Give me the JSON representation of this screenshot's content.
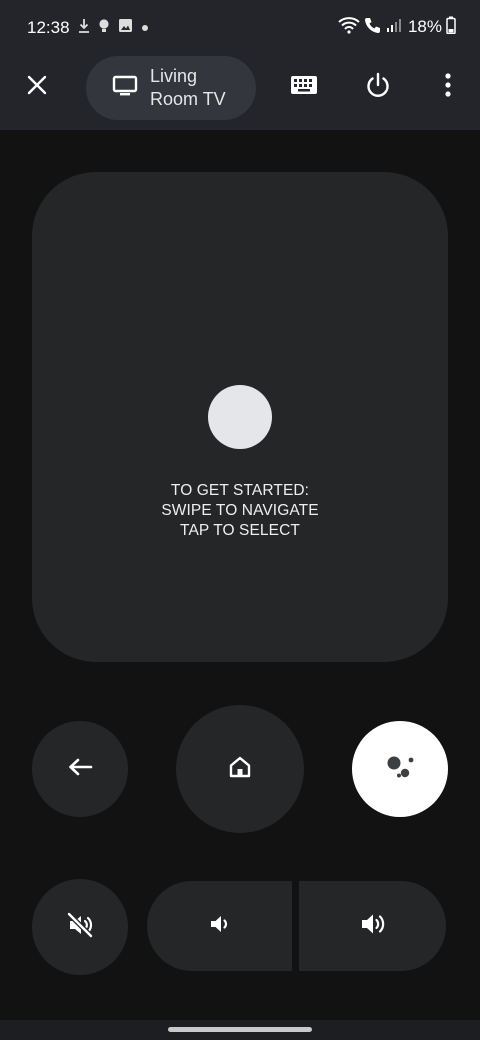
{
  "status_bar": {
    "time": "12:38",
    "battery": "18%",
    "left_icons": [
      "download-icon",
      "bulb-icon",
      "image-icon",
      "dot-icon"
    ],
    "right_icons": [
      "wifi-icon",
      "call-wifi-icon",
      "signal-icon",
      "battery-icon"
    ]
  },
  "toolbar": {
    "close_icon": "close-icon",
    "device_name": "Living Room TV",
    "device_icon": "tv-icon",
    "keyboard_icon": "keyboard-icon",
    "power_icon": "power-icon",
    "more_icon": "more-vert-icon"
  },
  "touchpad": {
    "hint_line1": "TO GET STARTED:",
    "hint_line2": "SWIPE TO NAVIGATE",
    "hint_line3": "TAP TO SELECT"
  },
  "controls": {
    "back_icon": "back-arrow-icon",
    "home_icon": "home-icon",
    "assistant_icon": "google-assistant-icon",
    "mute_icon": "volume-mute-icon",
    "volume_down_icon": "volume-down-icon",
    "volume_up_icon": "volume-up-icon"
  },
  "colors": {
    "background": "#121212",
    "toolbar": "#23252a",
    "button": "#252628",
    "assistant_button": "#ffffff",
    "touch_dot": "#e5e6ea"
  }
}
